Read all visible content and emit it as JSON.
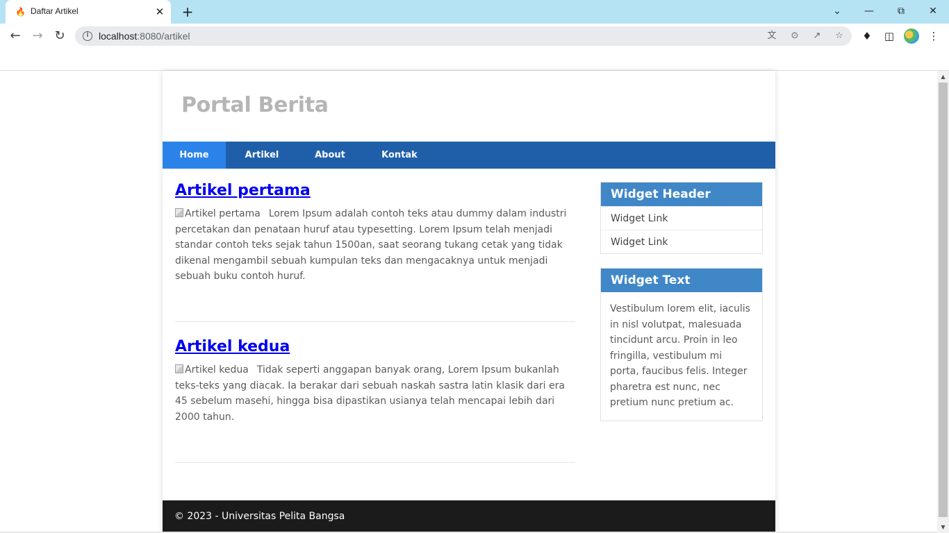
{
  "browser": {
    "tab": {
      "title": "Daftar Artikel",
      "favicon_icon": "fire-icon"
    },
    "url_host": "localhost",
    "url_path": ":8080/artikel",
    "window_controls": [
      "chevron-down-icon",
      "minimize-icon",
      "restore-icon",
      "close-icon"
    ],
    "toolbar_icons": [
      "back-arrow-icon",
      "forward-arrow-icon",
      "reload-icon"
    ],
    "omnibox_icons": [
      "translate-icon",
      "zoom-out-icon",
      "share-icon",
      "star-icon"
    ],
    "extension_icons": [
      "puzzle-icon",
      "side-panel-icon",
      "profile-avatar",
      "kebab-menu-icon"
    ]
  },
  "site": {
    "title": "Portal Berita",
    "nav": [
      {
        "label": "Home",
        "active": true
      },
      {
        "label": "Artikel",
        "active": false
      },
      {
        "label": "About",
        "active": false
      },
      {
        "label": "Kontak",
        "active": false
      }
    ],
    "articles": [
      {
        "title": "Artikel pertama",
        "image_alt": "Artikel pertama",
        "body": "Lorem Ipsum adalah contoh teks atau dummy dalam industri percetakan dan penataan huruf atau typesetting. Lorem Ipsum telah menjadi standar contoh teks sejak tahun 1500an, saat seorang tukang cetak yang tidak dikenal mengambil sebuah kumpulan teks dan mengacaknya untuk menjadi sebuah buku contoh huruf."
      },
      {
        "title": "Artikel kedua",
        "image_alt": "Artikel kedua",
        "body": "Tidak seperti anggapan banyak orang, Lorem Ipsum bukanlah teks-teks yang diacak. Ia berakar dari sebuah naskah sastra latin klasik dari era 45 sebelum masehi, hingga bisa dipastikan usianya telah mencapai lebih dari 2000 tahun."
      }
    ],
    "sidebar": {
      "widget1": {
        "header": "Widget Header",
        "links": [
          "Widget Link",
          "Widget Link"
        ]
      },
      "widget2": {
        "header": "Widget Text",
        "text": "Vestibulum lorem elit, iaculis in nisl volutpat, malesuada tincidunt arcu. Proin in leo fringilla, vestibulum mi porta, faucibus felis. Integer pharetra est nunc, nec pretium nunc pretium ac."
      }
    },
    "footer": "© 2023 - Universitas Pelita Bangsa"
  },
  "colors": {
    "tabstrip": "#b6e3f3",
    "nav_bg": "#1f5faa",
    "nav_active": "#2b83ea",
    "widget_header": "#3f87c7",
    "footer_bg": "#1b1b1b",
    "link": "#0000ee",
    "site_title": "#b5b5b5"
  }
}
